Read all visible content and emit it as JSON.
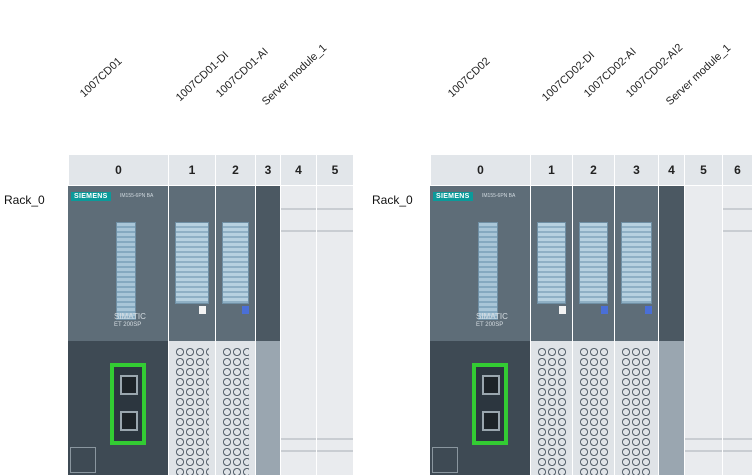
{
  "device1": {
    "labels": [
      "1007CD01",
      "1007CD01-DI",
      "1007CD01-AI",
      "Server module_1"
    ],
    "rack": "Rack_0",
    "slots": [
      "0",
      "1",
      "2",
      "3",
      "4",
      "5"
    ],
    "head": {
      "brand": "SIEMENS",
      "part": "IM155-6PN BA",
      "product": "SIMATIC",
      "model": "ET 200SP"
    }
  },
  "device2": {
    "labels": [
      "1007CD02",
      "1007CD02-DI",
      "1007CD02-AI",
      "1007CD02-AI2",
      "Server module_1"
    ],
    "rack": "Rack_0",
    "slots": [
      "0",
      "1",
      "2",
      "3",
      "4",
      "5",
      "6"
    ],
    "head": {
      "brand": "SIEMENS",
      "part": "IM155-6PN BA",
      "product": "SIMATIC",
      "model": "ET 200SP"
    }
  },
  "colors": {
    "port_highlight": "#33cc33",
    "brand": "#0b9a9a",
    "head": "#5e6d78",
    "empty_slot": "#e9ebee"
  }
}
